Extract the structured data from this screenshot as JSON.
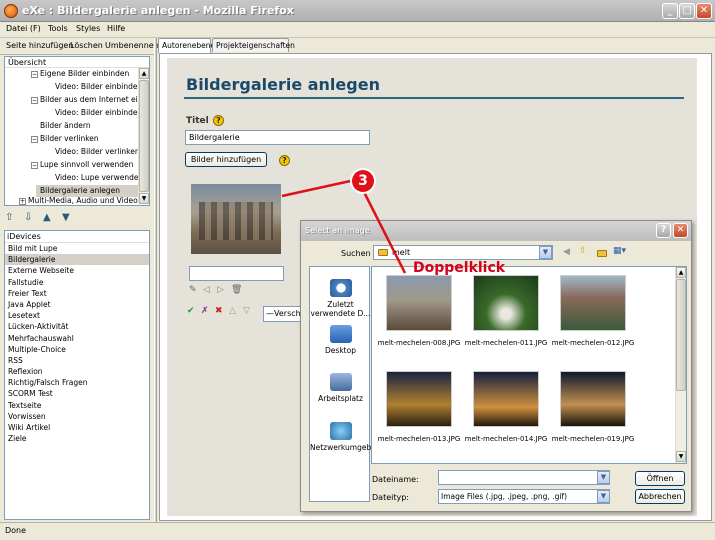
{
  "window": {
    "title": "eXe : Bildergalerie anlegen - Mozilla Firefox"
  },
  "menu": [
    "Datei (F)",
    "Tools",
    "Styles",
    "Hilfe"
  ],
  "left_toolbar": [
    "Seite hinzufügen",
    "Löschen",
    "Umbenennen"
  ],
  "outline": {
    "header": "Übersicht",
    "nodes": [
      {
        "label": "Eigene Bilder einbinden",
        "expander": "−"
      },
      {
        "label": "Video: Bilder einbinde..."
      },
      {
        "label": "Bilder aus dem Internet ei...",
        "expander": "−"
      },
      {
        "label": "Video: Bilder einbinde..."
      },
      {
        "label": "Bilder ändern"
      },
      {
        "label": "Bilder verlinken",
        "expander": "−"
      },
      {
        "label": "Video: Bilder verlinken"
      },
      {
        "label": "Lupe sinnvoll verwenden",
        "expander": "−"
      },
      {
        "label": "Video: Lupe verwenden"
      },
      {
        "label": "Bildergalerie anlegen",
        "selected": true
      },
      {
        "label": "Multi-Media, Audio und Video ...",
        "expander": "+"
      }
    ]
  },
  "move_buttons": [
    "⇧",
    "⇩",
    "▲",
    "▼"
  ],
  "idevices": {
    "header": "iDevices",
    "items": [
      "Bild mit Lupe",
      "Bildergalerie",
      "Externe Webseite",
      "Fallstudie",
      "Freier Text",
      "Java Applet",
      "Lesetext",
      "Lücken-Aktivität",
      "Mehrfachauswahl",
      "Multiple-Choice",
      "RSS",
      "Reflexion",
      "Richtig/Falsch Fragen",
      "SCORM Test",
      "Textseite",
      "Vorwissen",
      "Wiki Artikel",
      "Ziele"
    ],
    "selected": "Bildergalerie"
  },
  "tabs": [
    "Autorenebene",
    "Projekteigenschaften"
  ],
  "editor": {
    "page_title": "Bildergalerie anlegen",
    "title_label": "Titel",
    "title_value": "Bildergalerie",
    "add_images_label": "Bilder hinzufügen",
    "dropdown_value": "—Versch"
  },
  "dialog": {
    "title": "Select an image",
    "look_in_label": "Suchen in:",
    "look_in_value": "melt",
    "places": [
      "Zuletzt verwendete D...",
      "Desktop",
      "Arbeitsplatz",
      "Netzwerkumgebung"
    ],
    "files": [
      "melt-mechelen-008.JPG",
      "melt-mechelen-011.JPG",
      "melt-mechelen-012.JPG",
      "melt-mechelen-013.JPG",
      "melt-mechelen-014.JPG",
      "melt-mechelen-019.JPG"
    ],
    "filename_label": "Dateiname:",
    "filename_value": "",
    "filetype_label": "Dateityp:",
    "filetype_value": "Image Files (.jpg, .jpeg, .png, .gif)",
    "open_label": "Öffnen",
    "cancel_label": "Abbrechen"
  },
  "annotations": {
    "step": "3",
    "hint": "Doppelklick"
  },
  "status": "Done",
  "colors": {
    "accent": "#1a4a6a",
    "annotation": "#e0101a",
    "selection": "#d4d0c8"
  }
}
